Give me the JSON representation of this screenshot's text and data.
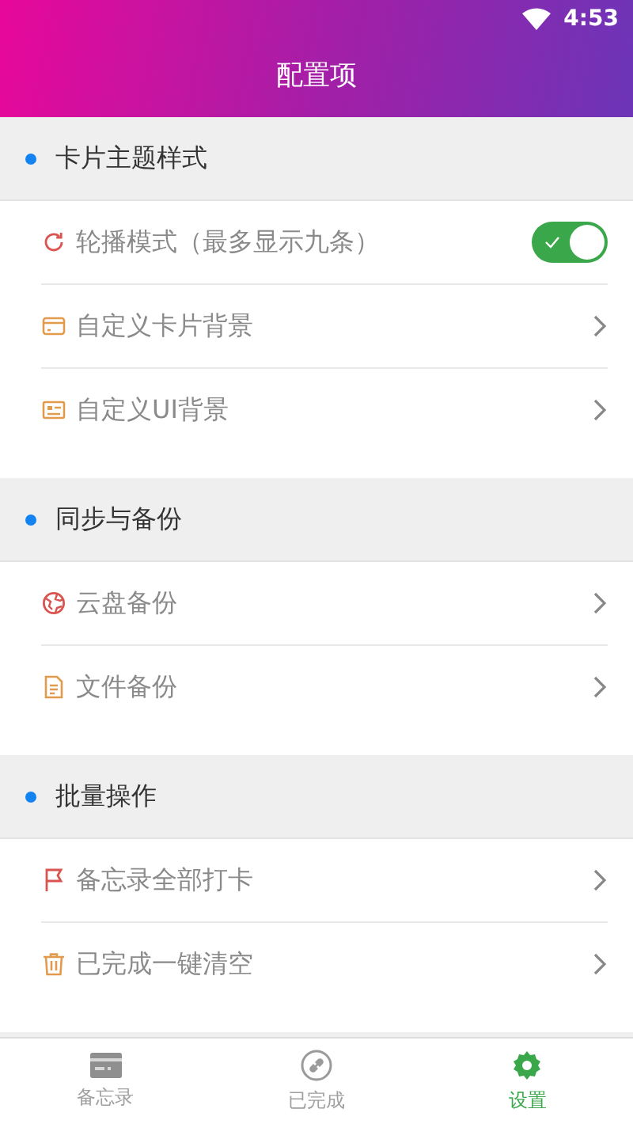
{
  "status_bar": {
    "time": "4:53"
  },
  "header": {
    "title": "配置项"
  },
  "sections": [
    {
      "title": "卡片主题样式",
      "items": [
        {
          "kind": "toggle",
          "label": "轮播模式（最多显示九条）",
          "on": true
        },
        {
          "kind": "link",
          "label": "自定义卡片背景"
        },
        {
          "kind": "link",
          "label": "自定义UI背景"
        }
      ]
    },
    {
      "title": "同步与备份",
      "items": [
        {
          "kind": "link",
          "label": "云盘备份"
        },
        {
          "kind": "link",
          "label": "文件备份"
        }
      ]
    },
    {
      "title": "批量操作",
      "items": [
        {
          "kind": "link",
          "label": "备忘录全部打卡"
        },
        {
          "kind": "link",
          "label": "已完成一键清空"
        }
      ]
    }
  ],
  "tabs": [
    {
      "label": "备忘录",
      "selected": false
    },
    {
      "label": "已完成",
      "selected": false
    },
    {
      "label": "设置",
      "selected": true
    }
  ]
}
